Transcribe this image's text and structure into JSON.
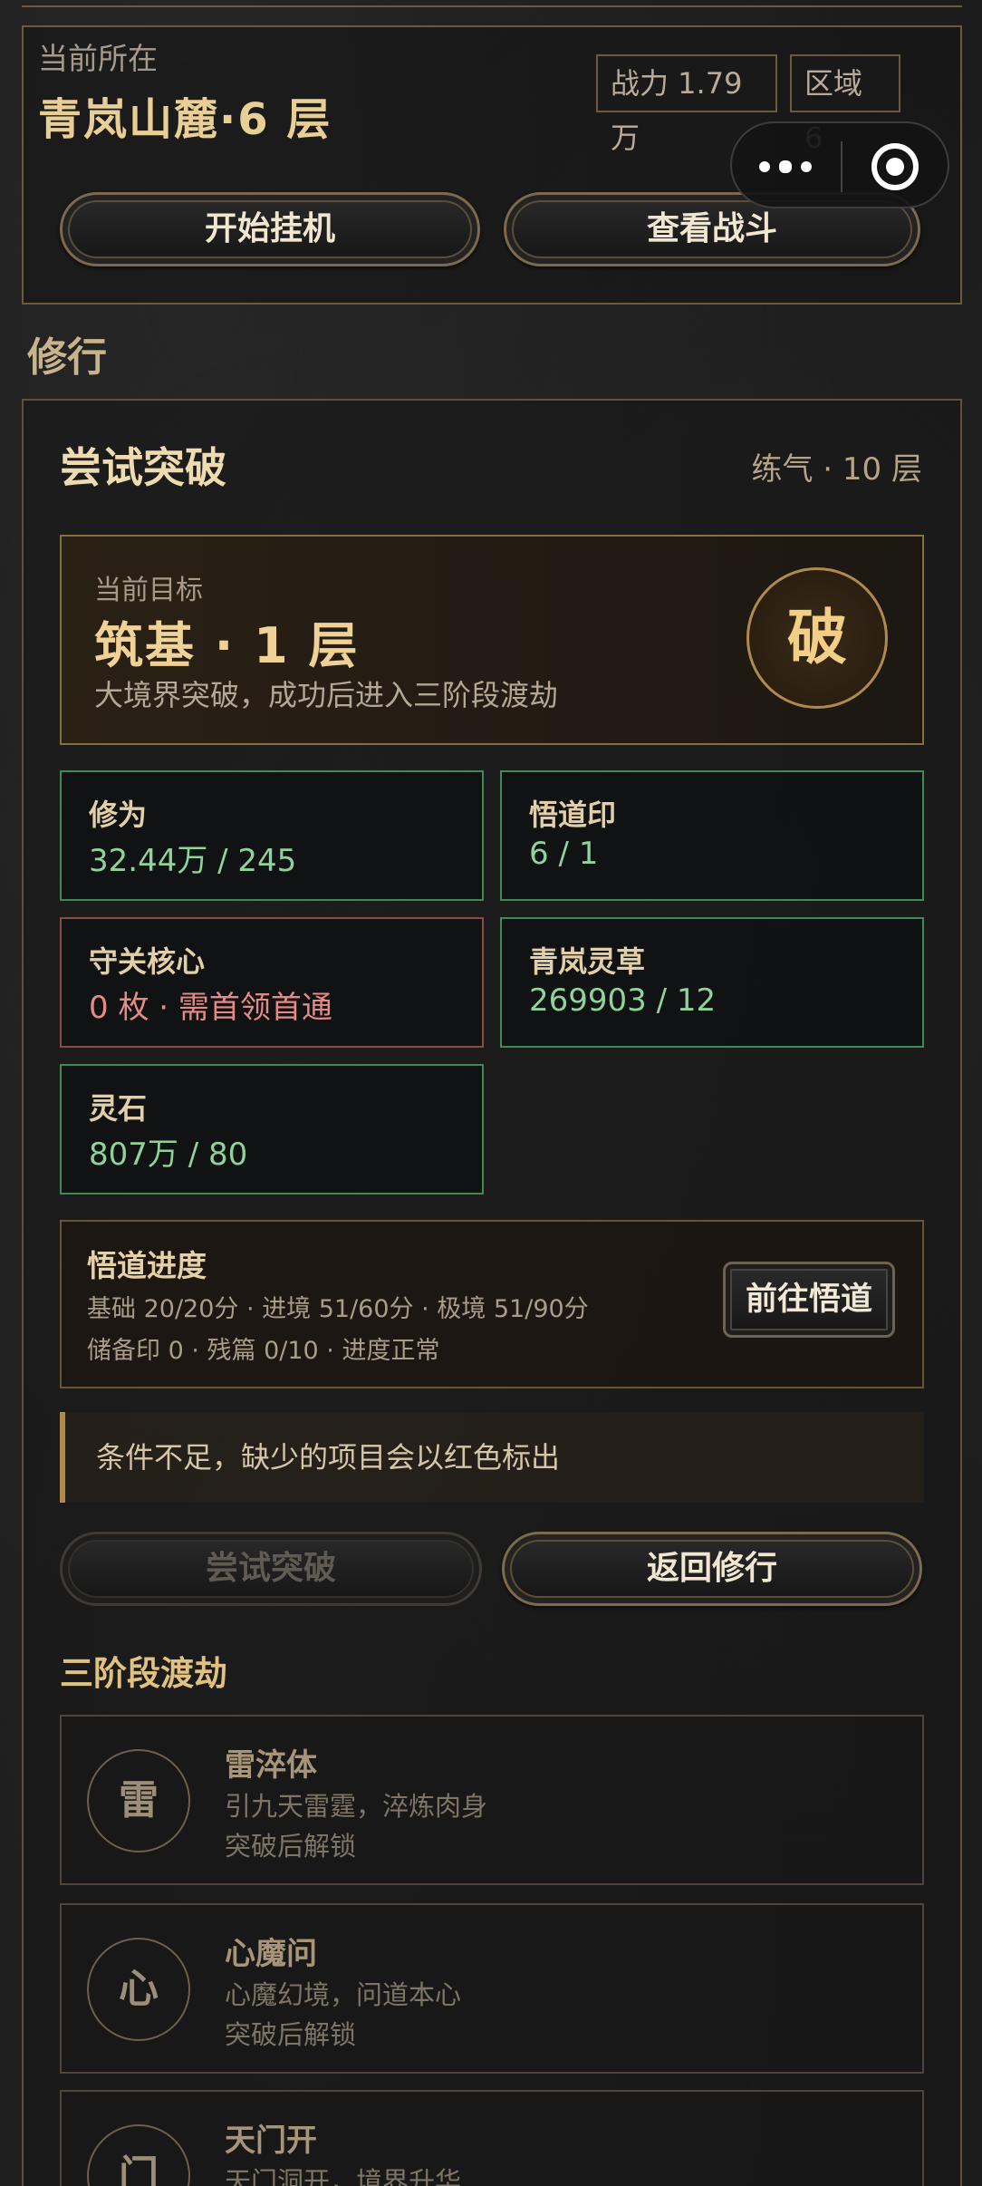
{
  "location": {
    "label": "当前所在",
    "title": "青岚山麓·6 层",
    "power": "战力 1.79万",
    "zone": "区域 6",
    "start_idle": "开始挂机",
    "view_battle": "查看战斗"
  },
  "capsule": {
    "more_icon": "more-dots-icon",
    "close_icon": "target-circle-icon"
  },
  "section_title": "修行",
  "breakthrough": {
    "title": "尝试突破",
    "current_realm": "练气 · 10 层",
    "target_label": "当前目标",
    "target_title": "筑基 · 1 层",
    "target_desc": "大境界突破，成功后进入三阶段渡劫",
    "break_char": "破"
  },
  "stats": [
    {
      "name": "修为",
      "value": "32.44万 / 245",
      "status": "ok"
    },
    {
      "name": "悟道印",
      "value": "6 / 1",
      "status": "ok"
    },
    {
      "name": "守关核心",
      "value": "0 枚 · 需首领首通",
      "status": "missing"
    },
    {
      "name": "青岚灵草",
      "value": "269903 / 12",
      "status": "ok"
    },
    {
      "name": "灵石",
      "value": "807万 / 80",
      "status": "ok"
    }
  ],
  "progress": {
    "title": "悟道进度",
    "line1": "基础 20/20分 · 进境 51/60分 · 极境 51/90分",
    "line2": "储备印 0 · 残篇 0/10 · 进度正常",
    "goto_label": "前往悟道"
  },
  "notice": "条件不足，缺少的项目会以红色标出",
  "actions": {
    "attempt": "尝试突破",
    "back": "返回修行"
  },
  "trials_title": "三阶段渡劫",
  "trials": [
    {
      "icon_char": "雷",
      "name": "雷淬体",
      "desc": "引九天雷霆，淬炼肉身",
      "state": "突破后解锁"
    },
    {
      "icon_char": "心",
      "name": "心魔问",
      "desc": "心魔幻境，问道本心",
      "state": "突破后解锁"
    },
    {
      "icon_char": "门",
      "name": "天门开",
      "desc": "天门洞开，境界升华",
      "state": ""
    }
  ],
  "colors": {
    "accent_gold": "#e6c98d",
    "ok_green": "#8fd39a",
    "missing_red": "#e58b86",
    "border_green": "#3f8a5b",
    "border_red": "#8c4a46"
  }
}
